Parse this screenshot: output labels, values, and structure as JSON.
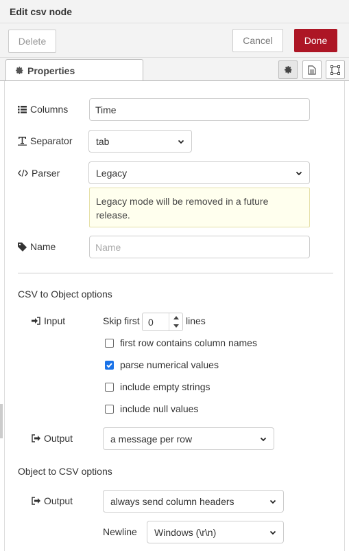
{
  "header": {
    "title": "Edit csv node"
  },
  "toolbar": {
    "delete_label": "Delete",
    "cancel_label": "Cancel",
    "done_label": "Done"
  },
  "tabs": {
    "properties_label": "Properties"
  },
  "form": {
    "columns": {
      "label": "Columns",
      "value": "Time"
    },
    "separator": {
      "label": "Separator",
      "value": "tab"
    },
    "parser": {
      "label": "Parser",
      "value": "Legacy",
      "tip": "Legacy mode will be removed in a future release."
    },
    "name": {
      "label": "Name",
      "placeholder": "Name"
    }
  },
  "csv_to_object": {
    "title": "CSV to Object options",
    "input_label": "Input",
    "skip_first_label": "Skip first",
    "skip_value": "0",
    "lines_label": "lines",
    "options": [
      {
        "label": "first row contains column names",
        "checked": false
      },
      {
        "label": "parse numerical values",
        "checked": true
      },
      {
        "label": "include empty strings",
        "checked": false
      },
      {
        "label": "include null values",
        "checked": false
      }
    ],
    "output_label": "Output",
    "output_value": "a message per row"
  },
  "object_to_csv": {
    "title": "Object to CSV options",
    "output_label": "Output",
    "output_value": "always send column headers",
    "newline_label": "Newline",
    "newline_value": "Windows (\\r\\n)"
  },
  "colors": {
    "done": "#ad1625",
    "checkbox": "#1a73e8",
    "tip_bg": "#ffffee"
  }
}
